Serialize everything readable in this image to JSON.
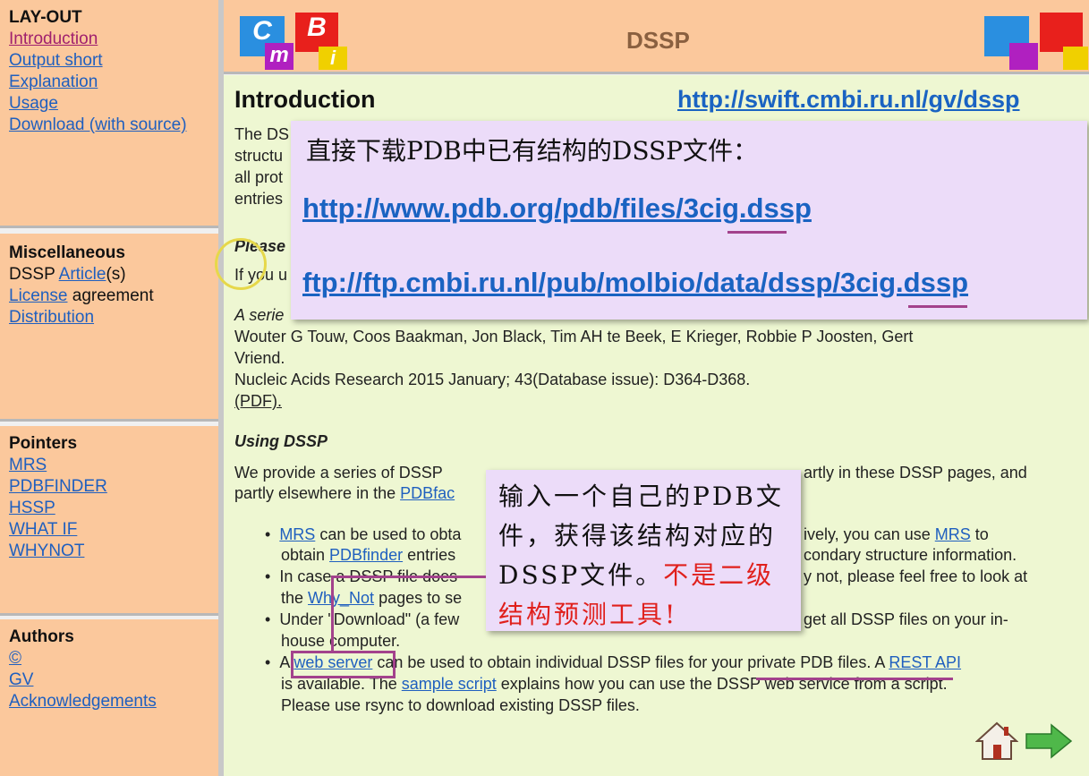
{
  "sidebar": {
    "layout": {
      "title": "LAY-OUT",
      "items": [
        "Introduction",
        "Output short",
        "Explanation",
        "Usage",
        "Download (with source)"
      ]
    },
    "misc": {
      "title": "Miscellaneous",
      "dssp_prefix": "DSSP ",
      "article": "Article",
      "article_suffix": "(s)",
      "license": "License",
      "license_suffix": " agreement",
      "distribution": "Distribution"
    },
    "pointers": {
      "title": "Pointers",
      "items": [
        "MRS",
        "PDBFINDER",
        "HSSP",
        "WHAT IF",
        "WHYNOT"
      ]
    },
    "authors": {
      "title": "Authors",
      "items": [
        "©",
        "GV",
        "Acknowledgements"
      ]
    }
  },
  "header": {
    "title": "DSSP",
    "logo_letters": [
      "C",
      "m",
      "B",
      "i"
    ]
  },
  "main": {
    "heading": "Introduction",
    "url": "http://swift.cmbi.ru.nl/gv/dssp",
    "intro_fragments": [
      "The DS",
      "structu",
      "all prot",
      "entries"
    ],
    "please_heading": "Please",
    "please_text": "If you u",
    "citation_title": "A serie",
    "citation_authors_1": "Wouter G Touw, Coos Baakman, Jon Black, Tim AH te Beek, E Krieger, Robbie P Joosten, Gert",
    "citation_authors_2": "Vriend.",
    "citation_journal": "Nucleic Acids Research 2015 January; 43(Database issue): D364-D368.",
    "pdf_link": "(PDF).",
    "using_heading": "Using DSSP",
    "p1_left": "We provide a series of DSSP",
    "p1_right": "artly in these DSSP pages, and",
    "p2_left": "partly elsewhere in the ",
    "p2_link": "PDBfac",
    "b1_l1": [
      " can be used to obta",
      "MRS"
    ],
    "b1_r1": [
      "ively, you can use ",
      "MRS",
      " to"
    ],
    "b1_l2": [
      "obtain ",
      "PDBfinder",
      " entries"
    ],
    "b1_r2": "condary structure information.",
    "b2_l1": "In case a DSSP file does",
    "b2_r1": "y not, please feel free to look at",
    "b2_l2": [
      "the ",
      "Why_Not",
      " pages to se"
    ],
    "b3_l1": "Under \"Download\" (a few",
    "b3_r1": "get all DSSP files on your in-",
    "b3_l2": "house computer.",
    "b4_l1": [
      "A ",
      "web server",
      " can be used to obtain individual DSSP files for your private PDB files. A ",
      "REST API"
    ],
    "b4_l2": [
      "is available. The ",
      "sample script",
      " explains how you can use the DSSP web service from a script."
    ],
    "b4_l3": "Please use rsync to download existing DSSP files."
  },
  "callout1": {
    "text": "直接下载PDB中已有结构的DSSP文件：",
    "url1": "http://www.pdb.org/pdb/files/3cig.dssp",
    "url2": "ftp://ftp.cmbi.ru.nl/pub/molbio/data/dssp/3cig.dssp"
  },
  "callout2": {
    "text": "输入一个自己的PDB文件，获得该结构对应的DSSP文件。",
    "warning": "不是二级结构预测工具!"
  },
  "icons": [
    "home-icon",
    "next-arrow-icon"
  ],
  "colors": {
    "sidebar": "#fbc89c",
    "content": "#eef7d2",
    "link": "#1f5fbf",
    "callout": "#ecdcf9",
    "annotation": "#a3428c",
    "warning": "#e0201c"
  }
}
